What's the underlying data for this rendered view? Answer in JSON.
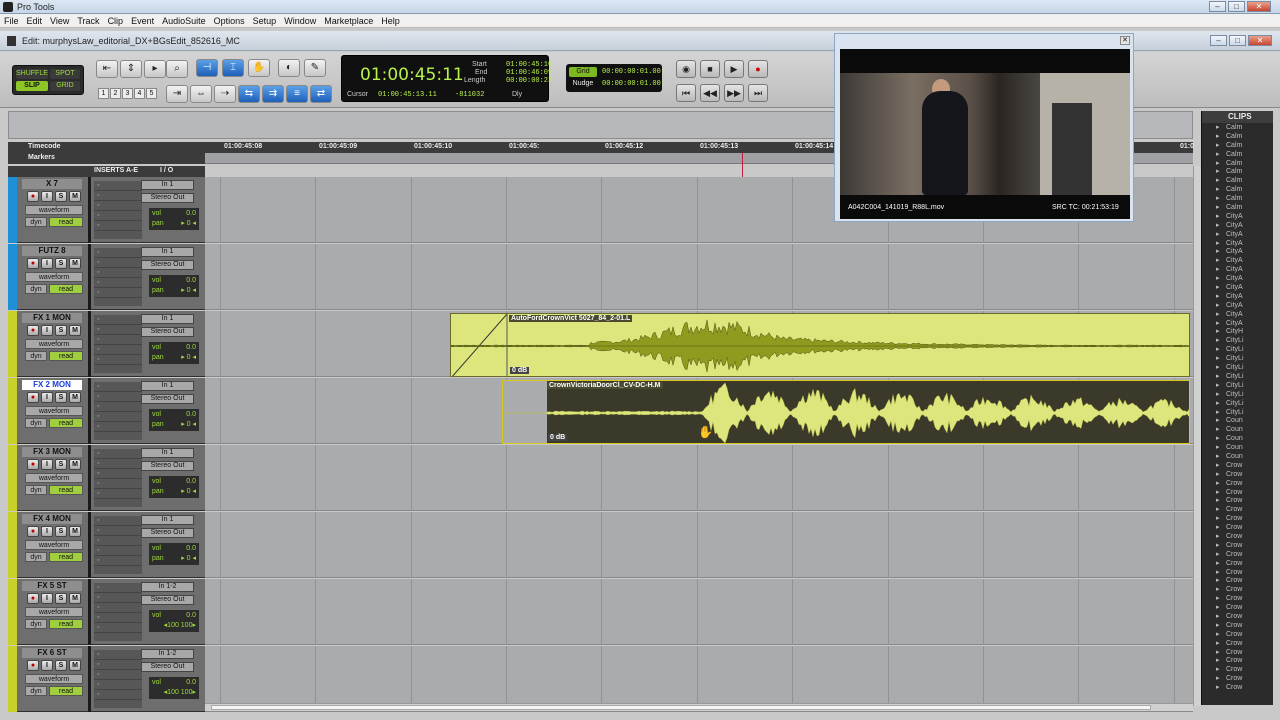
{
  "app": {
    "title": "Pro Tools"
  },
  "menu": [
    "File",
    "Edit",
    "View",
    "Track",
    "Clip",
    "Event",
    "AudioSuite",
    "Options",
    "Setup",
    "Window",
    "Marketplace",
    "Help"
  ],
  "edit_window": {
    "title": "Edit: murphysLaw_editorial_DX+BGsEdit_852616_MC"
  },
  "modes": {
    "shuffle": "SHUFFLE",
    "spot": "SPOT",
    "slip": "SLIP",
    "grid": "GRID"
  },
  "tool_numbers": [
    "1",
    "2",
    "3",
    "4",
    "5"
  ],
  "counter": {
    "main": "01:00:45:11",
    "start_label": "Start",
    "start": "01:00:45:10",
    "end_label": "End",
    "end": "01:00:46:09",
    "length_label": "Length",
    "length": "00:00:00:23",
    "cursor_label": "Cursor",
    "cursor": "01:00:45:13.11",
    "sample_offset": "-811032",
    "dly_label": "Dly"
  },
  "grid": {
    "grid_label": "Grid",
    "grid_value": "00:00:00:01.00",
    "nudge_label": "Nudge",
    "nudge_value": "00:00:00:01.00"
  },
  "ruler": {
    "timecode_label": "Timecode",
    "markers_label": "Markers",
    "ticks": [
      "01:00:45:08",
      "01:00:45:09",
      "01:00:45:10",
      "01:00:45:",
      "01:00:45:12",
      "01:00:45:13",
      "01:00:45:14",
      "01:0"
    ]
  },
  "columns": {
    "inserts": "INSERTS A-E",
    "io": "I / O"
  },
  "tracks": [
    {
      "name": "X 7",
      "input": "In 1",
      "output": "Stereo Out",
      "view": "waveform",
      "auto": "dyn",
      "mode": "read",
      "vol_label": "vol",
      "vol": "0.0",
      "pan_label": "pan",
      "pan": "▸ 0 ◂",
      "color": "#1f8fd6",
      "selected": false
    },
    {
      "name": "FUTZ 8",
      "input": "In 1",
      "output": "Stereo Out",
      "view": "waveform",
      "auto": "dyn",
      "mode": "read",
      "vol_label": "vol",
      "vol": "0.0",
      "pan_label": "pan",
      "pan": "▸ 0 ◂",
      "color": "#1f8fd6",
      "selected": false
    },
    {
      "name": "FX 1 MON",
      "input": "In 1",
      "output": "Stereo Out",
      "view": "waveform",
      "auto": "dyn",
      "mode": "read",
      "vol_label": "vol",
      "vol": "0.0",
      "pan_label": "pan",
      "pan": "▸ 0 ◂",
      "color": "#c8d02a",
      "selected": false
    },
    {
      "name": "FX 2 MON",
      "input": "In 1",
      "output": "Stereo Out",
      "view": "waveform",
      "auto": "dyn",
      "mode": "read",
      "vol_label": "vol",
      "vol": "0.0",
      "pan_label": "pan",
      "pan": "▸ 0 ◂",
      "color": "#c8d02a",
      "selected": true
    },
    {
      "name": "FX 3 MON",
      "input": "In 1",
      "output": "Stereo Out",
      "view": "waveform",
      "auto": "dyn",
      "mode": "read",
      "vol_label": "vol",
      "vol": "0.0",
      "pan_label": "pan",
      "pan": "▸ 0 ◂",
      "color": "#c8d02a",
      "selected": false
    },
    {
      "name": "FX 4 MON",
      "input": "In 1",
      "output": "Stereo Out",
      "view": "waveform",
      "auto": "dyn",
      "mode": "read",
      "vol_label": "vol",
      "vol": "0.0",
      "pan_label": "pan",
      "pan": "▸ 0 ◂",
      "color": "#c8d02a",
      "selected": false
    },
    {
      "name": "FX 5 ST",
      "input": "In 1-2",
      "output": "Stereo Out",
      "view": "waveform",
      "auto": "dyn",
      "mode": "read",
      "vol_label": "vol",
      "vol": "0.0",
      "pan_label": "",
      "pan": "◂100  100▸",
      "color": "#c8d02a",
      "selected": false
    },
    {
      "name": "FX 6 ST",
      "input": "In 1-2",
      "output": "Stereo Out",
      "view": "waveform",
      "auto": "dyn",
      "mode": "read",
      "vol_label": "vol",
      "vol": "0.0",
      "pan_label": "",
      "pan": "◂100  100▸",
      "color": "#c8d02a",
      "selected": false
    }
  ],
  "clips": [
    {
      "name": "AutoFordCrownVict 5027_84_2-01.L",
      "gain": "0 dB"
    },
    {
      "name": "CrownVictoriaDoorCl_CV-DC-H.M",
      "gain": "0 dB"
    }
  ],
  "video": {
    "filename": "A042C004_141019_R88L.mov",
    "src_tc": "SRC TC: 00:21:53:19"
  },
  "clips_panel": {
    "title": "CLIPS",
    "items": [
      "Calm",
      "Calm",
      "Calm",
      "Calm",
      "Calm",
      "Calm",
      "Calm",
      "Calm",
      "Calm",
      "Calm",
      "CityA",
      "CityA",
      "CityA",
      "CityA",
      "CityA",
      "CityA",
      "CityA",
      "CityA",
      "CityA",
      "CityA",
      "CityA",
      "CityA",
      "CityA",
      "CityH",
      "CityLi",
      "CityLi",
      "CityLi",
      "CityLi",
      "CityLi",
      "CityLi",
      "CityLi",
      "CityLi",
      "CityLi",
      "Coun",
      "Coun",
      "Coun",
      "Coun",
      "Coun",
      "Crow",
      "Crow",
      "Crow",
      "Crow",
      "Crow",
      "Crow",
      "Crow",
      "Crow",
      "Crow",
      "Crow",
      "Crow",
      "Crow",
      "Crow",
      "Crow",
      "Crow",
      "Crow",
      "Crow",
      "Crow",
      "Crow",
      "Crow",
      "Crow",
      "Crow",
      "Crow",
      "Crow",
      "Crow",
      "Crow"
    ]
  }
}
